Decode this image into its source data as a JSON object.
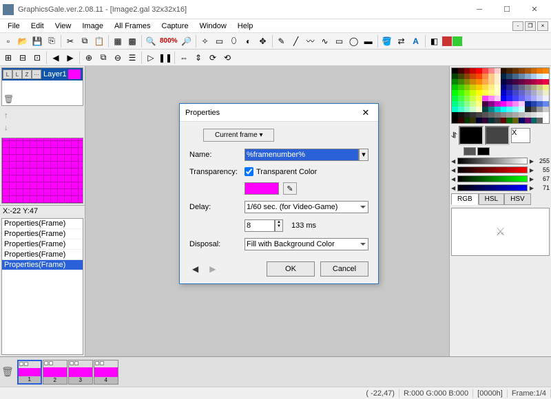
{
  "title": "GraphicsGale.ver.2.08.11 - [Image2.gal 32x32x16]",
  "menu": [
    "File",
    "Edit",
    "View",
    "Image",
    "All Frames",
    "Capture",
    "Window",
    "Help"
  ],
  "zoom": "800%",
  "layer": {
    "name": "Layer1",
    "cells": [
      "L1",
      "L2",
      "Z2",
      "···"
    ]
  },
  "coords": "X:-22 Y:47",
  "history": [
    "Properties(Frame)",
    "Properties(Frame)",
    "Properties(Frame)",
    "Properties(Frame)",
    "Properties(Frame)"
  ],
  "history_selected": 4,
  "tabs": {
    "items": [
      "RGB",
      "HSL",
      "HSV"
    ],
    "active": 0
  },
  "gray_val": "255",
  "rgb": {
    "r": "55",
    "g": "67",
    "b": "71"
  },
  "frames": [
    1,
    2,
    3,
    4
  ],
  "frame_selected": 0,
  "status": {
    "pos": "( -22,47)",
    "color": "R:000 G:000 B:000",
    "hex": "[0000h]",
    "frame": "Frame:1/4"
  },
  "dialog": {
    "title": "Properties",
    "tab": "Current frame ▾",
    "name_label": "Name:",
    "name_value": "%framenumber%",
    "transparency_label": "Transparency:",
    "transparent_color_label": "Transparent Color",
    "transparent_checked": true,
    "delay_label": "Delay:",
    "delay_option": "1/60 sec. (for Video-Game)",
    "delay_value": "8",
    "delay_ms": "133 ms",
    "disposal_label": "Disposal:",
    "disposal_option": "Fill with Background Color",
    "ok": "OK",
    "cancel": "Cancel"
  },
  "palette_colors": [
    "#000",
    "#400",
    "#800",
    "#c00",
    "#f00",
    "#f44",
    "#f88",
    "#fcc",
    "#210",
    "#420",
    "#630",
    "#840",
    "#a50",
    "#c60",
    "#e70",
    "#f80",
    "#040",
    "#440",
    "#840",
    "#c40",
    "#f40",
    "#f84",
    "#fc8",
    "#fec",
    "#024",
    "#246",
    "#468",
    "#68a",
    "#8ac",
    "#ace",
    "#cef",
    "#eff",
    "#080",
    "#480",
    "#880",
    "#c80",
    "#f80",
    "#fa4",
    "#fc8",
    "#fec",
    "#004",
    "#204",
    "#404",
    "#604",
    "#804",
    "#a04",
    "#c04",
    "#e04",
    "#0c0",
    "#4c0",
    "#8c0",
    "#cc0",
    "#fc0",
    "#fd4",
    "#fe8",
    "#ffc",
    "#008",
    "#228",
    "#448",
    "#668",
    "#888",
    "#aa8",
    "#cc8",
    "#ee8",
    "#0f0",
    "#4f0",
    "#8f0",
    "#cf0",
    "#ff0",
    "#ff4",
    "#ff8",
    "#ffc",
    "#00c",
    "#22c",
    "#44c",
    "#66c",
    "#88c",
    "#aac",
    "#ccc",
    "#eec",
    "#0f4",
    "#4f4",
    "#8f4",
    "#cf4",
    "#ff4",
    "#f4f",
    "#f8f",
    "#fcf",
    "#00f",
    "#22f",
    "#44f",
    "#66f",
    "#88f",
    "#aaf",
    "#ccf",
    "#eef",
    "#0f8",
    "#4f8",
    "#8f8",
    "#cf8",
    "#ff8",
    "#404",
    "#808",
    "#c0c",
    "#f0f",
    "#f4f",
    "#f8f",
    "#fcf",
    "#028",
    "#24a",
    "#46c",
    "#68e",
    "#0fc",
    "#4fc",
    "#8fc",
    "#cfc",
    "#ffc",
    "#044",
    "#088",
    "#0cc",
    "#0ff",
    "#4ff",
    "#8ff",
    "#cff",
    "#222",
    "#555",
    "#999",
    "#ccc",
    "#000",
    "#111",
    "#222",
    "#333",
    "#444",
    "#555",
    "#666",
    "#777",
    "#888",
    "#999",
    "#aaa",
    "#bbb",
    "#ccc",
    "#ddd",
    "#eee",
    "#fff",
    "#000",
    "#300",
    "#030",
    "#330",
    "#003",
    "#303",
    "#033",
    "#333",
    "#600",
    "#060",
    "#660",
    "#006",
    "#606",
    "#066",
    "#666",
    "#fff"
  ]
}
